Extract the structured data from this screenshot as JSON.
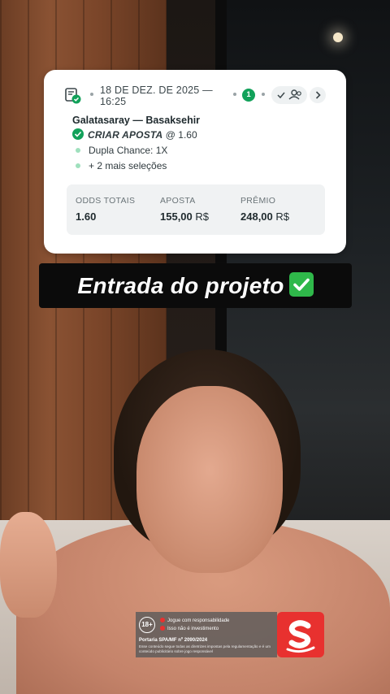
{
  "bet_card": {
    "date": "18 DE DEZ. DE 2025 — 16:25",
    "selection_count": "1",
    "match": "Galatasaray — Basaksehir",
    "criar_label": "CRIAR APOSTA",
    "criar_odds": "@ 1.60",
    "market": "Dupla Chance: 1X",
    "more_selections": "+ 2 mais seleções",
    "summary": {
      "odds_label": "ODDS TOTAIS",
      "odds_value": "1.60",
      "stake_label": "APOSTA",
      "stake_value": "155,00",
      "stake_unit": "R$",
      "prize_label": "PRÊMIO",
      "prize_value": "248,00",
      "prize_unit": "R$"
    }
  },
  "caption": {
    "text": "Entrada do projeto"
  },
  "disclaimer": {
    "age": "18+",
    "line1": "Jogue com responsabilidade",
    "line2": "Isso não é investimento",
    "portaria": "Portaria SPA/MF nº 2090/2024",
    "fineprint": "Esse conteúdo segue todas as diretrizes impostas pela regulamentação e é um conteúdo publicitário sobre jogo responsável"
  },
  "icons": {
    "ticket": "ticket-check-icon",
    "share": "share-people-icon",
    "next": "chevron-right-icon",
    "caption_emoji": "check-mark-button-icon",
    "logo": "sportingbet-s-logo"
  },
  "colors": {
    "accent_green": "#12a15a",
    "brand_red": "#e8312f",
    "caption_bg": "#0b0b0b"
  }
}
